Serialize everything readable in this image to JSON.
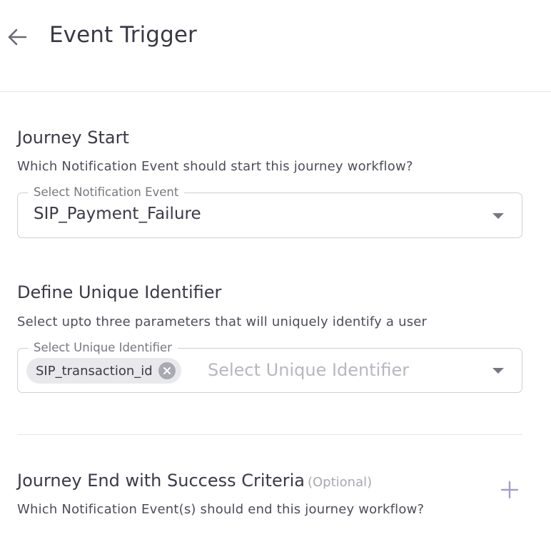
{
  "header": {
    "title": "Event Trigger",
    "back_icon": "arrow-left-icon"
  },
  "journey_start": {
    "title": "Journey Start",
    "description": "Which Notification Event should start this journey workflow?",
    "field": {
      "legend": "Select Notification Event",
      "value": "SIP_Payment_Failure",
      "icon": "caret-down-icon"
    }
  },
  "unique_identifier": {
    "title": "Define Unique Identifier",
    "description": "Select upto three parameters that will uniquely identify a user",
    "field": {
      "legend": "Select Unique Identifier",
      "placeholder": "Select Unique Identifier",
      "chips": [
        {
          "label": "SIP_transaction_id",
          "icon": "close-circle-icon"
        }
      ],
      "icon": "caret-down-icon"
    }
  },
  "journey_end": {
    "title": "Journey End with Success Criteria",
    "optional_label": "(Optional)",
    "description": "Which Notification Event(s) should end this journey workflow?",
    "add_icon": "plus-icon"
  },
  "colors": {
    "text_primary": "#3a3a47",
    "text_muted": "#77777f",
    "border": "#cfcfd6",
    "divider": "#e5e5ea",
    "chip_bg": "#e9e9ed"
  }
}
